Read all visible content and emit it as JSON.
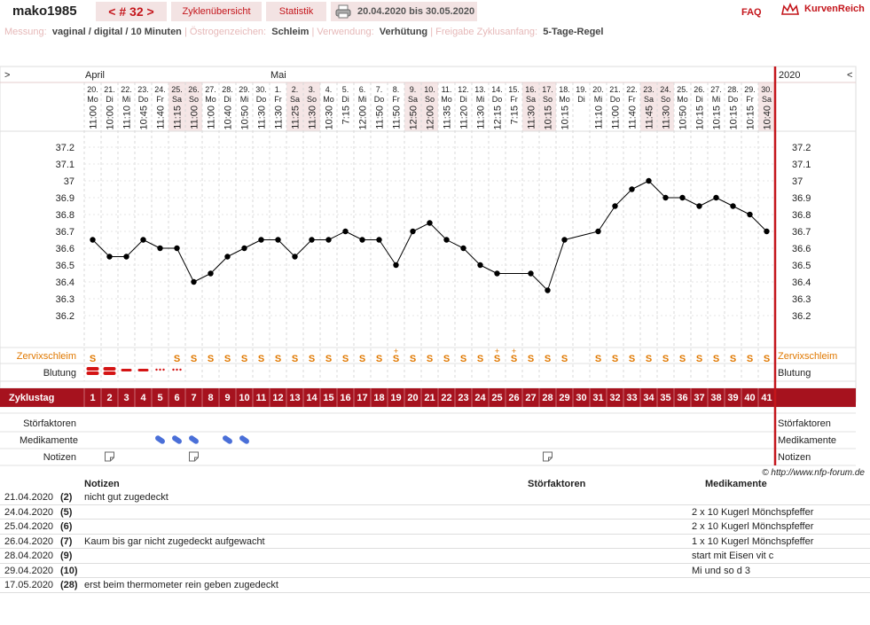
{
  "header": {
    "username": "mako1985",
    "cycle_nav": "< # 32 >",
    "tab_overview": "Zyklenübersicht",
    "tab_stats": "Statistik",
    "date_range": "20.04.2020 bis 30.05.2020",
    "faq": "FAQ",
    "logo": "KurvenReich"
  },
  "meta": {
    "l1": "Messung:",
    "v1": "vaginal / digital / 10 Minuten",
    "l2": "Östrogenzeichen:",
    "v2": "Schleim",
    "l3": "Verwendung:",
    "v3": "Verhütung",
    "l4": "Freigabe Zyklusanfang:",
    "v4": "5-Tage-Regel"
  },
  "chart_nav": {
    "left": ">",
    "right": "<",
    "year": "2020",
    "month1": "April",
    "month2": "Mai"
  },
  "colors": {
    "accent": "#c4161c",
    "band": "#a6121e",
    "weekend": "#f5e6e6",
    "orange": "#e07800",
    "blue": "#4a6fd8"
  },
  "chart_data": {
    "type": "line",
    "ylim": [
      36.0,
      37.3
    ],
    "y_ticks": [
      "37.2",
      "37.1",
      "37",
      "36.9",
      "36.8",
      "36.7",
      "36.6",
      "36.5",
      "36.4",
      "36.3",
      "36.2"
    ],
    "days": [
      {
        "d": "20.",
        "w": "Mo",
        "t": "11:00",
        "we": false,
        "v": 36.65,
        "cd": "1",
        "mu": "S",
        "bl": "heavy"
      },
      {
        "d": "21.",
        "w": "Di",
        "t": "10:00",
        "we": false,
        "v": 36.55,
        "cd": "2",
        "mu": "",
        "bl": "heavy"
      },
      {
        "d": "22.",
        "w": "Mi",
        "t": "11:10",
        "we": false,
        "v": 36.55,
        "cd": "3",
        "mu": "",
        "bl": "medium"
      },
      {
        "d": "23.",
        "w": "Do",
        "t": "10:45",
        "we": false,
        "v": 36.65,
        "cd": "4",
        "mu": "",
        "bl": "medium"
      },
      {
        "d": "24.",
        "w": "Fr",
        "t": "11:40",
        "we": false,
        "v": 36.6,
        "cd": "5",
        "mu": "",
        "bl": "light"
      },
      {
        "d": "25.",
        "w": "Sa",
        "t": "11:15",
        "we": true,
        "v": 36.6,
        "cd": "6",
        "mu": "S",
        "bl": "light"
      },
      {
        "d": "26.",
        "w": "So",
        "t": "11:00",
        "we": true,
        "v": 36.4,
        "cd": "7",
        "mu": "S",
        "bl": ""
      },
      {
        "d": "27.",
        "w": "Mo",
        "t": "11:00",
        "we": false,
        "v": 36.45,
        "cd": "8",
        "mu": "S",
        "bl": ""
      },
      {
        "d": "28.",
        "w": "Di",
        "t": "10:40",
        "we": false,
        "v": 36.55,
        "cd": "9",
        "mu": "S",
        "bl": ""
      },
      {
        "d": "29.",
        "w": "Mi",
        "t": "10:50",
        "we": false,
        "v": 36.6,
        "cd": "10",
        "mu": "S",
        "bl": ""
      },
      {
        "d": "30.",
        "w": "Do",
        "t": "11:30",
        "we": false,
        "v": 36.65,
        "cd": "11",
        "mu": "S",
        "bl": ""
      },
      {
        "d": "1.",
        "w": "Fr",
        "t": "11:30",
        "we": false,
        "v": 36.65,
        "cd": "12",
        "mu": "S",
        "bl": ""
      },
      {
        "d": "2.",
        "w": "Sa",
        "t": "11:25",
        "we": true,
        "v": 36.55,
        "cd": "13",
        "mu": "S",
        "bl": ""
      },
      {
        "d": "3.",
        "w": "So",
        "t": "11:30",
        "we": true,
        "v": 36.65,
        "cd": "14",
        "mu": "S",
        "bl": ""
      },
      {
        "d": "4.",
        "w": "Mo",
        "t": "10:30",
        "we": false,
        "v": 36.65,
        "cd": "15",
        "mu": "S",
        "bl": ""
      },
      {
        "d": "5.",
        "w": "Di",
        "t": "7:15",
        "we": false,
        "v": 36.7,
        "cd": "16",
        "mu": "S",
        "bl": ""
      },
      {
        "d": "6.",
        "w": "Mi",
        "t": "12:00",
        "we": false,
        "v": 36.65,
        "cd": "17",
        "mu": "S",
        "bl": ""
      },
      {
        "d": "7.",
        "w": "Do",
        "t": "11:50",
        "we": false,
        "v": 36.65,
        "cd": "18",
        "mu": "S",
        "bl": ""
      },
      {
        "d": "8.",
        "w": "Fr",
        "t": "11:50",
        "we": false,
        "v": 36.5,
        "cd": "19",
        "mu": "S+",
        "bl": ""
      },
      {
        "d": "9.",
        "w": "Sa",
        "t": "12:50",
        "we": true,
        "v": 36.7,
        "cd": "20",
        "mu": "S",
        "bl": ""
      },
      {
        "d": "10.",
        "w": "So",
        "t": "12:00",
        "we": true,
        "v": 36.75,
        "cd": "21",
        "mu": "S",
        "bl": ""
      },
      {
        "d": "11.",
        "w": "Mo",
        "t": "11:35",
        "we": false,
        "v": 36.65,
        "cd": "22",
        "mu": "S",
        "bl": ""
      },
      {
        "d": "12.",
        "w": "Di",
        "t": "11:20",
        "we": false,
        "v": 36.6,
        "cd": "23",
        "mu": "S",
        "bl": ""
      },
      {
        "d": "13.",
        "w": "Mi",
        "t": "11:30",
        "we": false,
        "v": 36.5,
        "cd": "24",
        "mu": "S",
        "bl": ""
      },
      {
        "d": "14.",
        "w": "Do",
        "t": "12:15",
        "we": false,
        "v": 36.45,
        "cd": "25",
        "mu": "S+",
        "bl": ""
      },
      {
        "d": "15.",
        "w": "Fr",
        "t": "7:15",
        "we": false,
        "v": null,
        "cd": "26",
        "mu": "S+",
        "bl": ""
      },
      {
        "d": "16.",
        "w": "Sa",
        "t": "11:30",
        "we": true,
        "v": 36.45,
        "cd": "27",
        "mu": "S",
        "bl": ""
      },
      {
        "d": "17.",
        "w": "So",
        "t": "10:15",
        "we": true,
        "v": 36.35,
        "cd": "28",
        "mu": "S",
        "bl": ""
      },
      {
        "d": "18.",
        "w": "Mo",
        "t": "10:15",
        "we": false,
        "v": 36.65,
        "cd": "29",
        "mu": "S",
        "bl": ""
      },
      {
        "d": "19.",
        "w": "Di",
        "t": "",
        "we": false,
        "v": null,
        "cd": "30",
        "mu": "",
        "bl": ""
      },
      {
        "d": "20.",
        "w": "Mi",
        "t": "11:10",
        "we": false,
        "v": 36.7,
        "cd": "31",
        "mu": "S",
        "bl": ""
      },
      {
        "d": "21.",
        "w": "Do",
        "t": "11:00",
        "we": false,
        "v": 36.85,
        "cd": "32",
        "mu": "S",
        "bl": ""
      },
      {
        "d": "22.",
        "w": "Fr",
        "t": "11:40",
        "we": false,
        "v": 36.95,
        "cd": "33",
        "mu": "S",
        "bl": ""
      },
      {
        "d": "23.",
        "w": "Sa",
        "t": "11:45",
        "we": true,
        "v": 37.0,
        "cd": "34",
        "mu": "S",
        "bl": ""
      },
      {
        "d": "24.",
        "w": "So",
        "t": "11:30",
        "we": true,
        "v": 36.9,
        "cd": "35",
        "mu": "S",
        "bl": ""
      },
      {
        "d": "25.",
        "w": "Mo",
        "t": "10:50",
        "we": false,
        "v": 36.9,
        "cd": "36",
        "mu": "S",
        "bl": ""
      },
      {
        "d": "26.",
        "w": "Di",
        "t": "10:15",
        "we": false,
        "v": 36.85,
        "cd": "37",
        "mu": "S",
        "bl": ""
      },
      {
        "d": "27.",
        "w": "Mi",
        "t": "10:15",
        "we": false,
        "v": 36.9,
        "cd": "38",
        "mu": "S",
        "bl": ""
      },
      {
        "d": "28.",
        "w": "Do",
        "t": "10:15",
        "we": false,
        "v": 36.85,
        "cd": "39",
        "mu": "S",
        "bl": ""
      },
      {
        "d": "29.",
        "w": "Fr",
        "t": "10:15",
        "we": false,
        "v": 36.8,
        "cd": "40",
        "mu": "S",
        "bl": ""
      },
      {
        "d": "30.",
        "w": "Sa",
        "t": "10:40",
        "we": true,
        "v": 36.7,
        "cd": "41",
        "mu": "S",
        "bl": ""
      }
    ],
    "medication_days": [
      5,
      6,
      7,
      9,
      10
    ],
    "note_days": [
      2,
      7,
      28
    ]
  },
  "rows": {
    "mucus": "Zervixschleim",
    "bleed": "Blutung",
    "cycleday": "Zyklustag",
    "disturb": "Störfaktoren",
    "meds": "Medikamente",
    "notes": "Notizen"
  },
  "copyright": "© http://www.nfp-forum.de",
  "table": {
    "h_notes": "Notizen",
    "h_disturb": "Störfaktoren",
    "h_meds": "Medikamente",
    "rows": [
      {
        "date": "21.04.2020",
        "day": "(2)",
        "note": "nicht gut zugedeckt",
        "dist": "",
        "med": ""
      },
      {
        "date": "24.04.2020",
        "day": "(5)",
        "note": "",
        "dist": "",
        "med": "2 x 10 Kugerl Mönchspfeffer"
      },
      {
        "date": "25.04.2020",
        "day": "(6)",
        "note": "",
        "dist": "",
        "med": "2 x 10 Kugerl Mönchspfeffer"
      },
      {
        "date": "26.04.2020",
        "day": "(7)",
        "note": "Kaum bis gar nicht zugedeckt aufgewacht",
        "dist": "",
        "med": "1 x 10 Kugerl Mönchspfeffer"
      },
      {
        "date": "28.04.2020",
        "day": "(9)",
        "note": "",
        "dist": "",
        "med": "start mit Eisen vit c"
      },
      {
        "date": "29.04.2020",
        "day": "(10)",
        "note": "",
        "dist": "",
        "med": "Mi und so d 3"
      },
      {
        "date": "17.05.2020",
        "day": "(28)",
        "note": "erst beim thermometer rein geben zugedeckt",
        "dist": "",
        "med": ""
      }
    ]
  }
}
